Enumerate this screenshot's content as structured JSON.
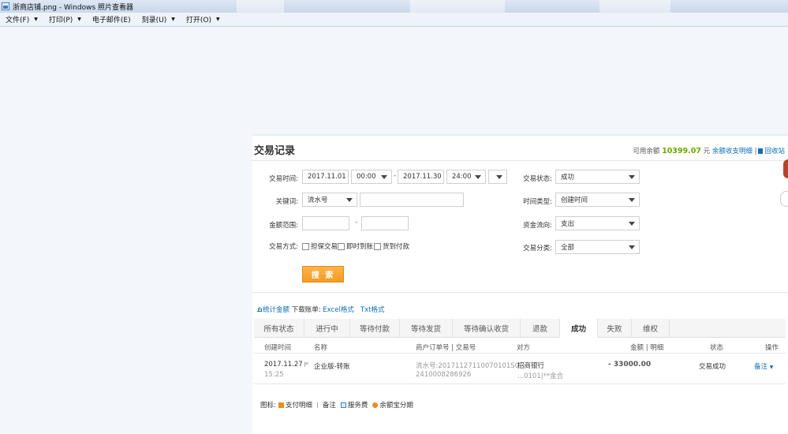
{
  "window": {
    "title": "浙商店铺.png - Windows 照片查看器"
  },
  "menubar": [
    {
      "label": "文件(F)"
    },
    {
      "label": "打印(P)"
    },
    {
      "label": "电子邮件(E)"
    },
    {
      "label": "刻录(U)"
    },
    {
      "label": "打开(O)"
    }
  ],
  "page": {
    "title": "交易记录",
    "balance_label": "可用余额",
    "balance_value": "10399.07",
    "balance_unit": "元",
    "balance_link": "余额收支明细",
    "recycle_link": "回收站"
  },
  "filters": {
    "time_label": "交易时间:",
    "start_date": "2017.11.01",
    "start_time": "00:00",
    "end_date": "2017.11.30",
    "end_time": "24:00",
    "range_sep": "-",
    "keyword_label": "关键词:",
    "keyword_type": "流水号",
    "keyword_value": "",
    "amount_label": "金额范围:",
    "amount_min": "",
    "amount_max": "",
    "amount_sep": "-",
    "method_label": "交易方式:",
    "methods": [
      "担保交易",
      "即时到账",
      "货到付款"
    ],
    "status_label": "交易状态:",
    "status_value": "成功",
    "timetype_label": "时间类型:",
    "timetype_value": "创建时间",
    "flow_label": "资金流向:",
    "flow_value": "支出",
    "category_label": "交易分类:",
    "category_value": "全部",
    "search_button": "搜 索"
  },
  "stats": {
    "stats_link": "统计金额",
    "download_label": "下载账单:",
    "excel_link": "Excel格式",
    "txt_link": "Txt格式"
  },
  "tabs": [
    {
      "label": "所有状态",
      "active": false
    },
    {
      "label": "进行中",
      "active": false
    },
    {
      "label": "等待付款",
      "active": false
    },
    {
      "label": "等待发货",
      "active": false
    },
    {
      "label": "等待确认收货",
      "active": false
    },
    {
      "label": "退款",
      "active": false
    },
    {
      "label": "成功",
      "active": true
    },
    {
      "label": "失败",
      "active": false
    },
    {
      "label": "维权",
      "active": false
    }
  ],
  "table": {
    "headers": {
      "created": "创建时间",
      "name": "名称",
      "order": "商户订单号 | 交易号",
      "party": "对方",
      "amount": "金额 | 明细",
      "status": "状态",
      "action": "操作"
    },
    "rows": [
      {
        "date": "2017.11.27",
        "time": "15:25",
        "name": "企业版-转账",
        "order_line1": "流水号:20171127110070101S0",
        "order_line2": "2410008286926",
        "party_line1": "招商银行",
        "party_line2": "...0101|**金合",
        "amount": "- 33000.00",
        "status": "交易成功",
        "action": "备注"
      }
    ]
  },
  "legend": {
    "label": "图标:",
    "items": [
      "支付明细",
      "备注",
      "服务费",
      "余额宝分期"
    ]
  }
}
